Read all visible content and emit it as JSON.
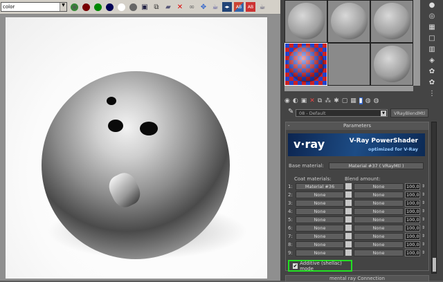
{
  "toolbar": {
    "channel": "color",
    "icons": [
      "rgb-icon",
      "red-channel-icon",
      "green-channel-icon",
      "blue-channel-icon",
      "alpha-icon",
      "mono-icon",
      "save-icon",
      "clone-icon",
      "open-icon",
      "clear-icon",
      "history-icon",
      "region-icon",
      "teapot-icon",
      "compare-icon",
      "ab-icon",
      "ab-active-icon",
      "render-icon"
    ]
  },
  "slots": {
    "count": 6
  },
  "editor": {
    "material_name": "08 - Default",
    "material_type": "VRayBlendMtl"
  },
  "rollout": {
    "title": "Parameters",
    "banner_logo": "v·ray",
    "banner_title": "V-Ray PowerShader",
    "banner_subtitle": "optimized for V-Ray",
    "base_label": "Base material:",
    "base_value": "Material #37  ( VRayMtl )",
    "coat_header": "Coat materials:",
    "blend_header": "Blend amount:",
    "rows": [
      {
        "idx": "1:",
        "coat": "Material #36",
        "blend": "None",
        "amount": "100,0"
      },
      {
        "idx": "2:",
        "coat": "None",
        "blend": "None",
        "amount": "100,0"
      },
      {
        "idx": "3:",
        "coat": "None",
        "blend": "None",
        "amount": "100,0"
      },
      {
        "idx": "4:",
        "coat": "None",
        "blend": "None",
        "amount": "100,0"
      },
      {
        "idx": "5:",
        "coat": "None",
        "blend": "None",
        "amount": "100,0"
      },
      {
        "idx": "6:",
        "coat": "None",
        "blend": "None",
        "amount": "100,0"
      },
      {
        "idx": "7:",
        "coat": "None",
        "blend": "None",
        "amount": "100,0"
      },
      {
        "idx": "8:",
        "coat": "None",
        "blend": "None",
        "amount": "100,0"
      },
      {
        "idx": "9:",
        "coat": "None",
        "blend": "None",
        "amount": "100,0"
      }
    ],
    "additive_label": "Additive (shellac) mode",
    "additive_checked": true,
    "next_rollout": "mental ray Connection"
  },
  "colors": {
    "highlight": "#22e022",
    "panel": "#444444"
  }
}
